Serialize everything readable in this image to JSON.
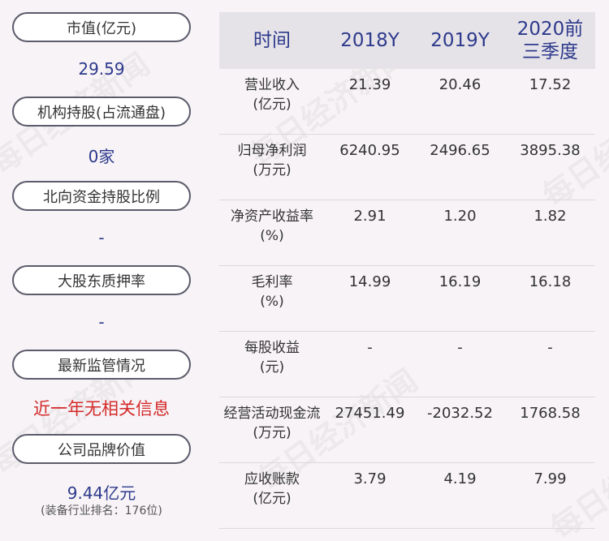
{
  "left": {
    "items": [
      {
        "label": "市值(亿元)",
        "value": "29.59"
      },
      {
        "label": "机构持股(占流通盘)",
        "value": "0家"
      },
      {
        "label": "北向资金持股比例",
        "value": "-"
      },
      {
        "label": "大股东质押率",
        "value": "-"
      },
      {
        "label": "最新监管情况",
        "value": "近一年无相关信息"
      },
      {
        "label": "公司品牌价值",
        "value": "9.44亿元",
        "sub": "(装备行业排名：176位)"
      }
    ]
  },
  "table": {
    "headers": [
      "时间",
      "2018Y",
      "2019Y",
      "2020前三季度"
    ],
    "rows": [
      {
        "label1": "营业收入",
        "label2": "(亿元)",
        "v": [
          "21.39",
          "20.46",
          "17.52"
        ]
      },
      {
        "label1": "归母净利润",
        "label2": "(万元)",
        "v": [
          "6240.95",
          "2496.65",
          "3895.38"
        ]
      },
      {
        "label1": "净资产收益率",
        "label2": "(%)",
        "v": [
          "2.91",
          "1.20",
          "1.82"
        ]
      },
      {
        "label1": "毛利率",
        "label2": "(%)",
        "v": [
          "14.99",
          "16.19",
          "16.18"
        ]
      },
      {
        "label1": "每股收益",
        "label2": "(元)",
        "v": [
          "-",
          "-",
          "-"
        ]
      },
      {
        "label1": "经营活动现金流",
        "label2": "(万元)",
        "v": [
          "27451.49",
          "-2032.52",
          "1768.58"
        ]
      },
      {
        "label1": "应收账款",
        "label2": "(亿元)",
        "v": [
          "3.79",
          "4.19",
          "7.99"
        ]
      }
    ]
  },
  "colors": {
    "accent": "#2d3a8c",
    "alert": "#d42a2a",
    "header_bg": "#e6e3e8",
    "page_bg": "#f7f3f6"
  },
  "watermark": "每日经济新闻"
}
